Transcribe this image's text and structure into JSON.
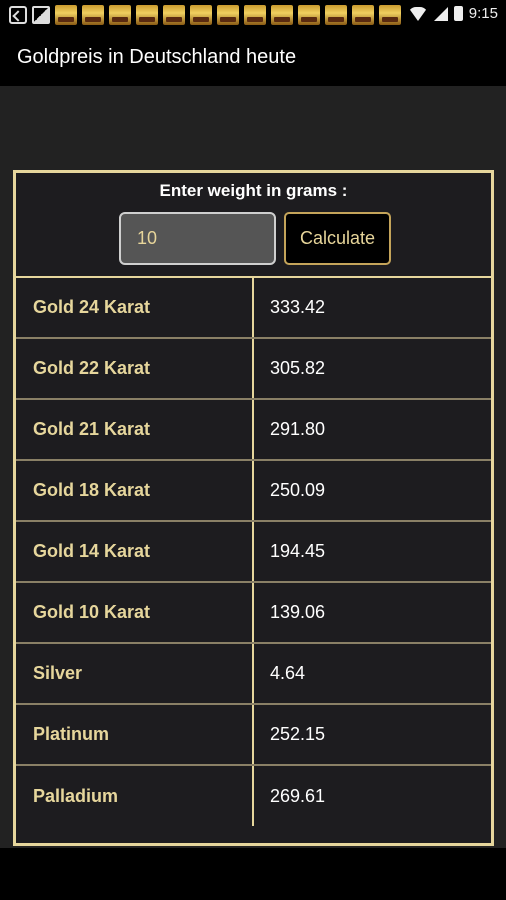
{
  "status_bar": {
    "time": "9:15",
    "left_icons": [
      "back-arrow-icon",
      "image-icon"
    ],
    "notification_count": 13
  },
  "app": {
    "title": "Goldpreis in Deutschland heute"
  },
  "form": {
    "label": "Enter weight in grams :",
    "weight_value": "10",
    "button_label": "Calculate"
  },
  "rows": [
    {
      "metal": "Gold 24 Karat",
      "price": "333.42"
    },
    {
      "metal": "Gold 22 Karat",
      "price": "305.82"
    },
    {
      "metal": "Gold 21 Karat",
      "price": "291.80"
    },
    {
      "metal": "Gold 18 Karat",
      "price": "250.09"
    },
    {
      "metal": "Gold 14 Karat",
      "price": "194.45"
    },
    {
      "metal": "Gold 10 Karat",
      "price": "139.06"
    },
    {
      "metal": "Silver",
      "price": "4.64"
    },
    {
      "metal": "Platinum",
      "price": "252.15"
    },
    {
      "metal": "Palladium",
      "price": "269.61"
    }
  ],
  "colors": {
    "accent_gold": "#e6d69c",
    "background": "#222222",
    "panel": "#1d1c1f"
  }
}
